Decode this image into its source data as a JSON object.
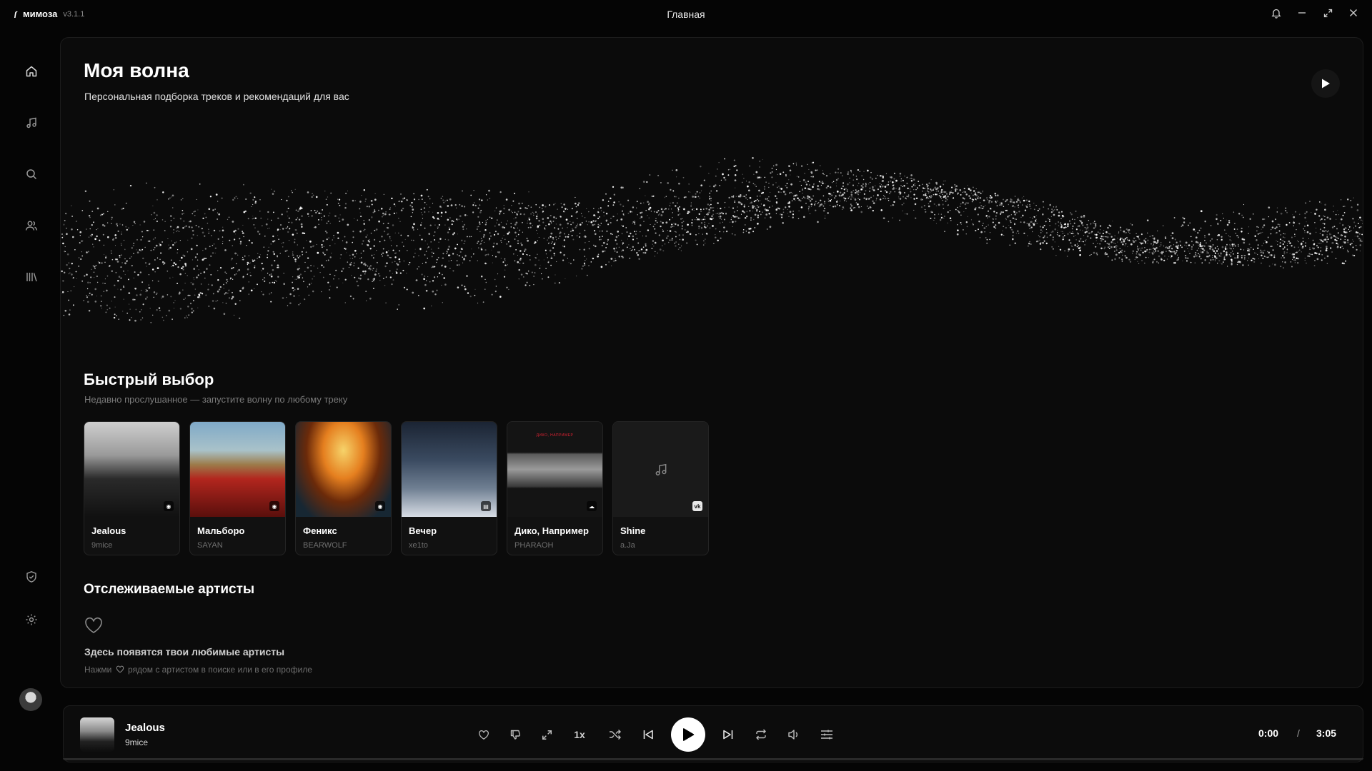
{
  "app": {
    "name": "мимоза",
    "version": "v3.1.1",
    "window_title": "Главная"
  },
  "window_controls": [
    "bell-icon",
    "minimize-icon",
    "maximize-icon",
    "close-icon"
  ],
  "sidebar": {
    "items": [
      {
        "name": "home",
        "icon": "home-icon"
      },
      {
        "name": "music",
        "icon": "music-note-icon"
      },
      {
        "name": "search",
        "icon": "search-icon"
      },
      {
        "name": "artists",
        "icon": "users-icon"
      },
      {
        "name": "library",
        "icon": "library-icon"
      }
    ],
    "bottom": [
      {
        "name": "security",
        "icon": "shield-icon"
      },
      {
        "name": "settings",
        "icon": "gear-icon"
      }
    ]
  },
  "hero": {
    "title": "Моя волна",
    "subtitle": "Персональная подборка треков и рекомендаций для вас"
  },
  "quick_pick": {
    "title": "Быстрый выбор",
    "subtitle": "Недавно прослушанное — запустите волну по любому треку",
    "cards": [
      {
        "title": "Jealous",
        "artist": "9mice"
      },
      {
        "title": "Мальборо",
        "artist": "SAYAN"
      },
      {
        "title": "Феникс",
        "artist": "BEARWOLF"
      },
      {
        "title": "Вечер",
        "artist": "xe1to"
      },
      {
        "title": "Дико, Например",
        "artist": "PHARAOH",
        "cover_caption": "ДИКО, НАПРИМЕР"
      },
      {
        "title": "Shine",
        "artist": "a.Ja"
      }
    ]
  },
  "followed": {
    "title": "Отслеживаемые артисты",
    "empty_title": "Здесь появятся твои любимые артисты",
    "empty_hint_before": "Нажми",
    "empty_hint_after": "рядом с артистом в поиске или в его профиле"
  },
  "player": {
    "title": "Jealous",
    "artist": "9mice",
    "speed": "1x",
    "current_time": "0:00",
    "separator": "/",
    "duration": "3:05",
    "progress": 0,
    "controls": [
      "heart-icon",
      "dislike-icon",
      "expand-icon",
      "speed",
      "shuffle-icon",
      "previous-icon",
      "play-icon",
      "next-icon",
      "repeat-icon",
      "volume-icon",
      "equalizer-icon"
    ]
  }
}
